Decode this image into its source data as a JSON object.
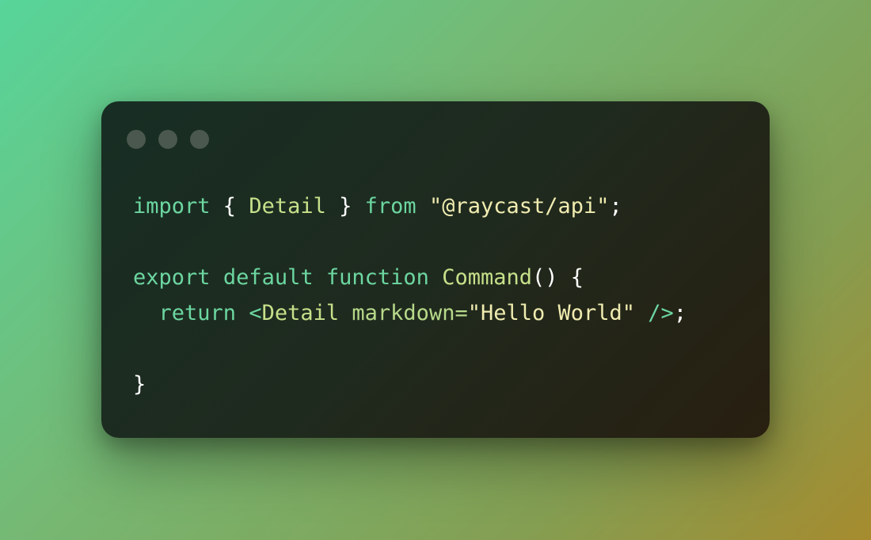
{
  "window": {
    "controls": [
      "close",
      "minimize",
      "zoom"
    ]
  },
  "code": {
    "line1": {
      "kw_import": "import",
      "brace_open": " { ",
      "ident_detail": "Detail",
      "brace_close": " } ",
      "kw_from": "from",
      "space": " ",
      "string_module": "\"@raycast/api\"",
      "semicolon": ";"
    },
    "line3": {
      "kw_export": "export",
      "kw_default": "default",
      "kw_function": "function",
      "func_name": "Command",
      "parens_brace": "() {"
    },
    "line4": {
      "indent": "  ",
      "kw_return": "return",
      "tag_open": "<",
      "tag_name": "Detail",
      "attr_name": "markdown=",
      "attr_value": "\"Hello World\"",
      "tag_close": " />",
      "semicolon": ";"
    },
    "line6": {
      "brace_close": "}"
    }
  },
  "colors": {
    "keyword": "#6cd6a0",
    "identifier": "#c6e08a",
    "string": "#f0ecb0",
    "punctuation": "#ffffff",
    "window_bg": "#1c2a20",
    "dot": "#4a584f"
  }
}
